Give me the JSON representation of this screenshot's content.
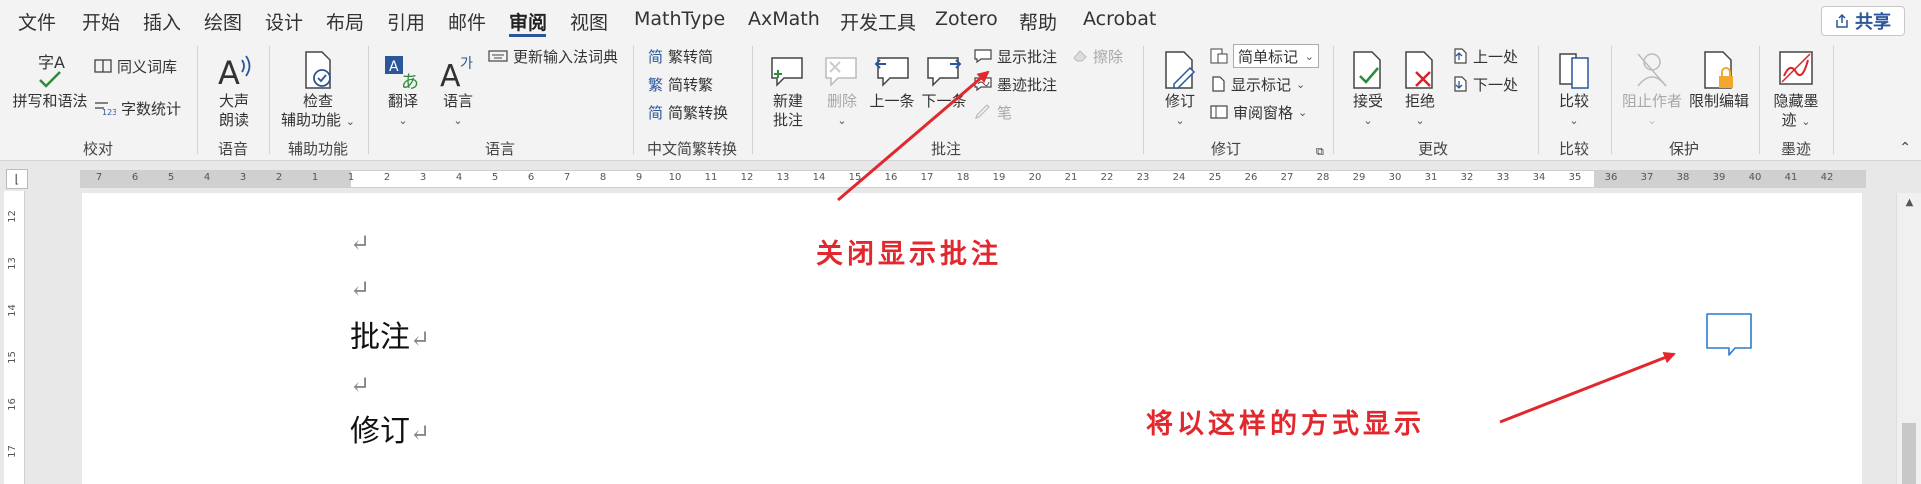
{
  "tabs": [
    "文件",
    "开始",
    "插入",
    "绘图",
    "设计",
    "布局",
    "引用",
    "邮件",
    "审阅",
    "视图",
    "MathType",
    "AxMath",
    "开发工具",
    "Zotero",
    "帮助",
    "Acrobat"
  ],
  "active_tab": "审阅",
  "share_label": "共享",
  "groups": {
    "proofing": {
      "title": "校对",
      "spelling": "拼写和语法",
      "thesaurus": "同义词库",
      "wordcount": "字数统计"
    },
    "speech": {
      "title": "语音",
      "read_aloud_1": "大声",
      "read_aloud_2": "朗读"
    },
    "accessibility": {
      "title": "辅助功能",
      "check_1": "检查",
      "check_2": "辅助功能"
    },
    "language": {
      "title": "语言",
      "translate": "翻译",
      "language": "语言",
      "update_ime": "更新输入法词典"
    },
    "chinese": {
      "title": "中文简繁转换",
      "t2s": "繁转简",
      "s2t": "简转繁",
      "convert": "简繁转换"
    },
    "comments": {
      "title": "批注",
      "new_1": "新建",
      "new_2": "批注",
      "delete": "删除",
      "prev": "上一条",
      "next": "下一条",
      "show": "显示批注",
      "ink": "墨迹批注",
      "erase": "擦除",
      "pen": "笔"
    },
    "tracking": {
      "title": "修订",
      "track": "修订",
      "markup_select": "简单标记",
      "show_markup": "显示标记",
      "review_pane": "审阅窗格"
    },
    "changes": {
      "title": "更改",
      "accept": "接受",
      "reject": "拒绝",
      "prev": "上一处",
      "next": "下一处"
    },
    "compare": {
      "title": "比较",
      "compare": "比较"
    },
    "protect": {
      "title": "保护",
      "block": "阻止作者",
      "restrict": "限制编辑"
    },
    "ink": {
      "title": "墨迹",
      "hide_1": "隐藏墨",
      "hide_2": "迹"
    }
  },
  "ruler_ticks": [
    "7",
    "6",
    "5",
    "4",
    "3",
    "2",
    "1",
    "1",
    "2",
    "3",
    "4",
    "5",
    "6",
    "7",
    "8",
    "9",
    "10",
    "11",
    "12",
    "13",
    "14",
    "15",
    "16",
    "17",
    "18",
    "19",
    "20",
    "21",
    "22",
    "23",
    "24",
    "25",
    "26",
    "27",
    "28",
    "29",
    "30",
    "31",
    "32",
    "33",
    "34",
    "35",
    "36",
    "37",
    "38",
    "39",
    "40",
    "41",
    "42"
  ],
  "vruler_ticks": [
    "12",
    "13",
    "14",
    "15",
    "16",
    "17"
  ],
  "document": {
    "para_mark": "↵",
    "line_comment": "批注",
    "line_revision": "修订"
  },
  "annotations": {
    "close_comments": "关闭显示批注",
    "display_mode": "将以这样的方式显示"
  },
  "colors": {
    "accent": "#2b579a",
    "annotation": "#e0282e",
    "green": "#2e8b3a"
  }
}
